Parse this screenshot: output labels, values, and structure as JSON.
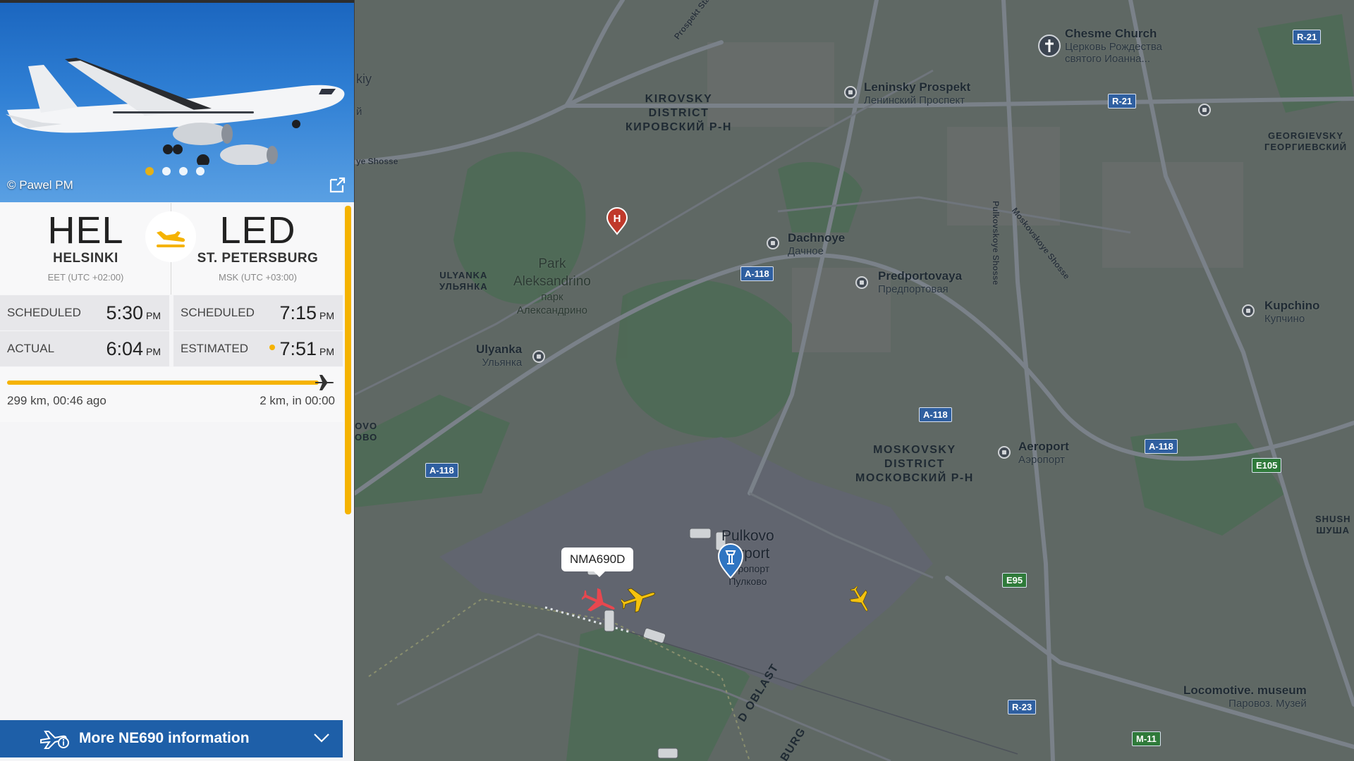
{
  "photo": {
    "credit": "© Pawel PM",
    "dots": 4,
    "active_dot": 0
  },
  "departure": {
    "code": "HEL",
    "city": "HELSINKI",
    "timezone": "EET (UTC +02:00)"
  },
  "arrival": {
    "code": "LED",
    "city": "ST. PETERSBURG",
    "timezone": "MSK (UTC +03:00)"
  },
  "times": {
    "dep_scheduled_label": "SCHEDULED",
    "dep_scheduled_time": "5:30",
    "dep_scheduled_ampm": "PM",
    "arr_scheduled_label": "SCHEDULED",
    "arr_scheduled_time": "7:15",
    "arr_scheduled_ampm": "PM",
    "dep_actual_label": "ACTUAL",
    "dep_actual_time": "6:04",
    "dep_actual_ampm": "PM",
    "arr_estimated_label": "ESTIMATED",
    "arr_estimated_time": "7:51",
    "arr_estimated_ampm": "PM"
  },
  "progress": {
    "left_text": "299 km, 00:46 ago",
    "right_text": "2 km, in 00:00",
    "percent": 99
  },
  "more_button": {
    "label": "More NE690 information"
  },
  "map": {
    "labels": {
      "chesme": "Chesme Church",
      "chesme_sub": "Церковь Рождества",
      "chesme_sub2": "святого Иоанна...",
      "leninsky": "Leninsky Prospekt",
      "leninsky_sub": "Ленинский Проспект",
      "kirovsky1": "KIROVSKY",
      "kirovsky2": "DISTRICT",
      "kirovsky3": "КИРОВСКИЙ Р-Н",
      "georgievsky1": "GEORGIEVSKY",
      "georgievsky2": "ГЕОРГИЕВСКИЙ",
      "dachnoye": "Dachnoye",
      "dachnoye_sub": "Дачное",
      "predportovaya": "Predportovaya",
      "predportovaya_sub": "Предпортовая",
      "kupchino": "Kupchino",
      "kupchino_sub": "Купчино",
      "park1": "Park",
      "park2": "Aleksandrino",
      "park3": "парк",
      "park4": "Александрино",
      "ulyanka_d1": "ULYANKA",
      "ulyanka_d2": "УЛЬЯНКА",
      "ulyanka": "Ulyanka",
      "ulyanka_sub": "Ульянка",
      "moskovsky1": "MOSKOVSKY",
      "moskovsky2": "DISTRICT",
      "moskovsky3": "МОСКОВСКИЙ Р-Н",
      "aeroport": "Aeroport",
      "aeroport_sub": "Аэропорт",
      "pulkovo1": "Pulkovo",
      "pulkovo2": "Airport",
      "pulkovo3": "Аэропорт",
      "pulkovo4": "Пулково",
      "locomotive": "Locomotive. museum",
      "locomotive_sub": "Паровоз. Музей",
      "shush1": "SHUSH",
      "shush2": "ШУША",
      "oblast": "D OBLAST",
      "burg": "BURG",
      "prospekt_stachek": "Prospekt Stachek",
      "pulkovskoye": "Pulkovskoye Shosse",
      "moskovskoye": "Moskovskoye Shosse",
      "shosse_left": "ye Shosse",
      "edge_kiy": "kiy",
      "edge_y": "й",
      "edge_ovo": "OVO",
      "edge_obo": "ОВО"
    },
    "shields": {
      "a118_1": "A-118",
      "a118_2": "A-118",
      "a118_3": "A-118",
      "a118_4": "A-118",
      "r21_1": "R-21",
      "r21_2": "R-21",
      "r23": "R-23",
      "e95": "E95",
      "e105": "E105",
      "m11": "M-11"
    },
    "hospital_marker": "H",
    "callsign": "NMA690D"
  }
}
